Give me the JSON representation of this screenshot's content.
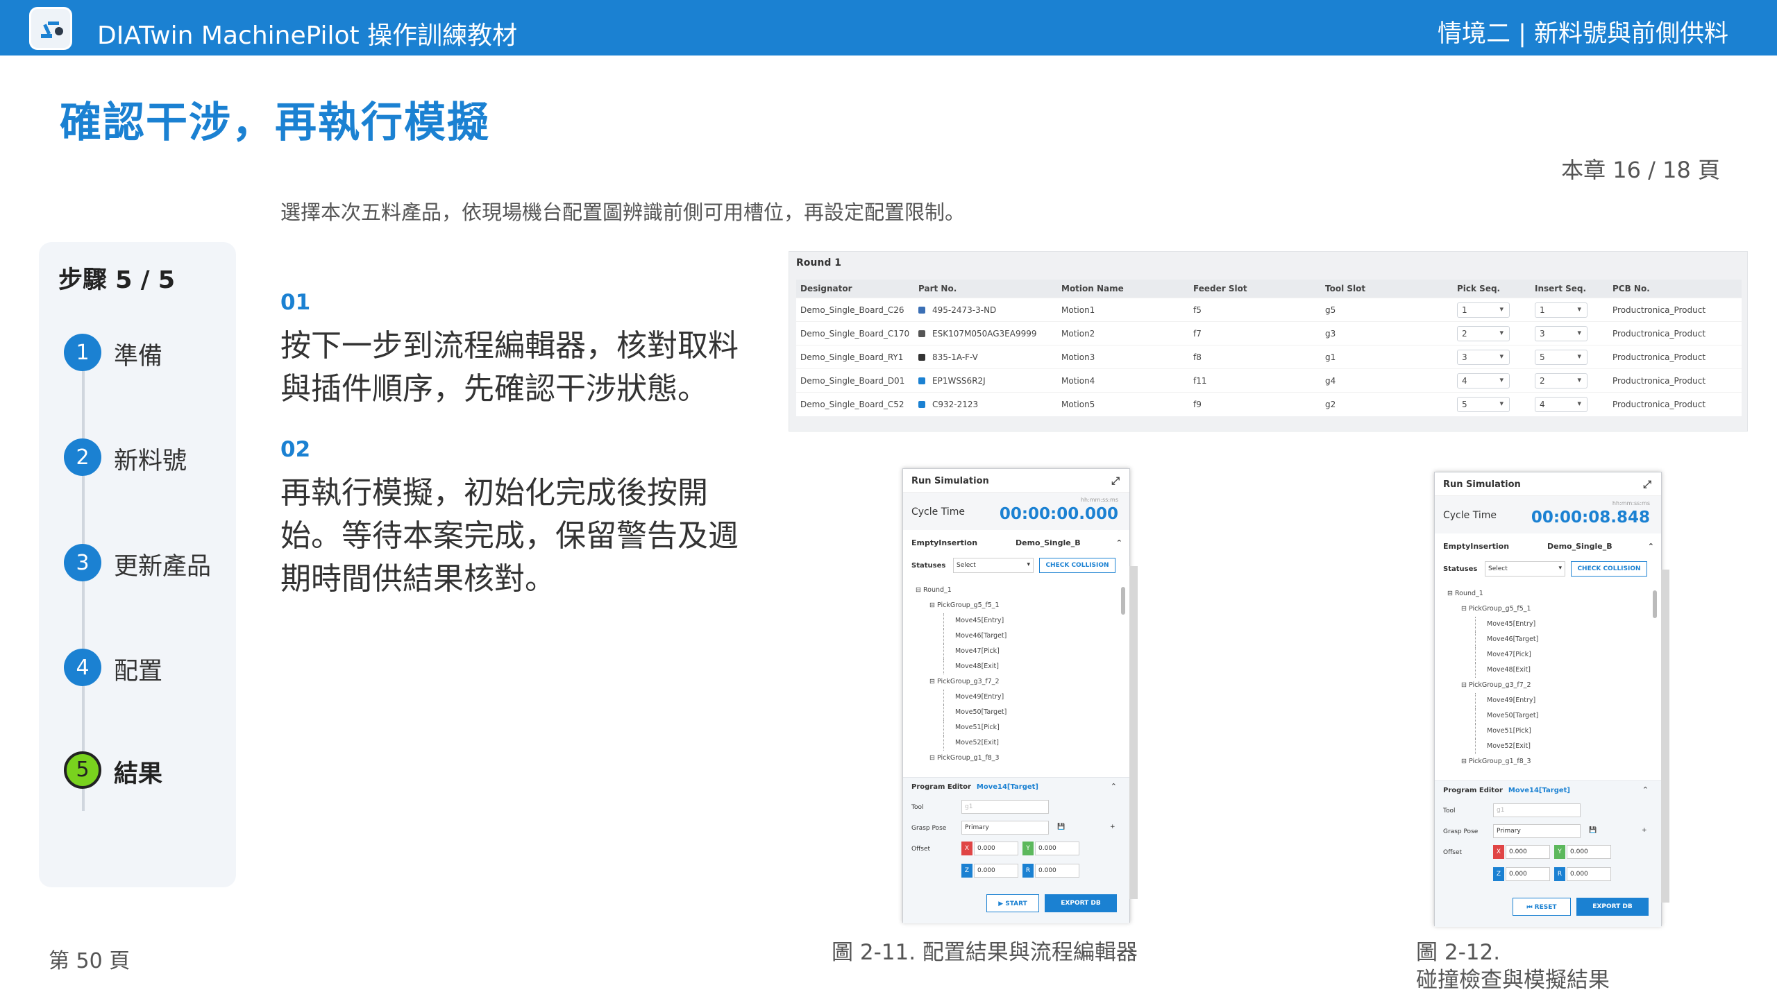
{
  "header": {
    "app_title": "DIATwin MachinePilot 操作訓練教材",
    "chapter": "情境二 | 新料號與前側供料"
  },
  "page": {
    "title": "確認干涉，再執行模擬",
    "progress": "本章 16 / 18 頁",
    "subtitle": "選擇本次五料產品，依現場機台配置圖辨識前側可用槽位，再設定配置限制。",
    "footer": "第 50 頁"
  },
  "steps": {
    "heading": "步驟 5 / 5",
    "items": [
      {
        "num": "1",
        "label": "準備"
      },
      {
        "num": "2",
        "label": "新料號"
      },
      {
        "num": "3",
        "label": "更新產品"
      },
      {
        "num": "4",
        "label": "配置"
      },
      {
        "num": "5",
        "label": "結果"
      }
    ]
  },
  "blocks": [
    {
      "num": "01",
      "text": "按下一步到流程編輯器，核對取料與插件順序，先確認干涉狀態。"
    },
    {
      "num": "02",
      "text": "再執行模擬，初始化完成後按開始。等待本案完成，保留警告及週期時間供結果核對。"
    }
  ],
  "table": {
    "round": "Round 1",
    "columns": [
      "Designator",
      "Part No.",
      "Motion Name",
      "Feeder Slot",
      "Tool Slot",
      "Pick Seq.",
      "Insert Seq.",
      "PCB No."
    ],
    "rows": [
      [
        "Demo_Single_Board_C26",
        "495-2473-3-ND",
        "Motion1",
        "f5",
        "g5",
        "1",
        "1",
        "Productronica_Product"
      ],
      [
        "Demo_Single_Board_C170",
        "ESK107M050AG3EA9999",
        "Motion2",
        "f7",
        "g3",
        "2",
        "3",
        "Productronica_Product"
      ],
      [
        "Demo_Single_Board_RY1",
        "835-1A-F-V",
        "Motion3",
        "f8",
        "g1",
        "3",
        "5",
        "Productronica_Product"
      ],
      [
        "Demo_Single_Board_D01",
        "EP1WSS6R2J",
        "Motion4",
        "f11",
        "g4",
        "4",
        "2",
        "Productronica_Product"
      ],
      [
        "Demo_Single_Board_C52",
        "C932-2123",
        "Motion5",
        "f9",
        "g2",
        "5",
        "4",
        "Productronica_Product"
      ]
    ]
  },
  "sim1": {
    "title": "Run Simulation",
    "cycle_label": "Cycle Time",
    "format": "hh:mm:ss:ms",
    "time": "00:00:00.000",
    "a1": "EmptyInsertion",
    "a2": "Demo_Single_B",
    "statuses": "Statuses",
    "select": "Select",
    "check": "CHECK COLLISION",
    "tree": [
      "Round_1",
      "PickGroup_g5_f5_1",
      "Move45[Entry]",
      "Move46[Target]",
      "Move47[Pick]",
      "Move48[Exit]",
      "PickGroup_g3_f7_2",
      "Move49[Entry]",
      "Move50[Target]",
      "Move51[Pick]",
      "Move52[Exit]",
      "PickGroup_g1_f8_3"
    ],
    "pe_label": "Program Editor",
    "pe_target": "Move14[Target]",
    "tool": "Tool",
    "tool_val": "g1",
    "grasp": "Grasp Pose",
    "grasp_val": "Primary",
    "offset": "Offset",
    "x": "0.000",
    "y": "0.000",
    "z": "0.000",
    "rz": "0.000",
    "btn_left": "▶ START",
    "btn_right": "EXPORT DB"
  },
  "sim2": {
    "title": "Run Simulation",
    "cycle_label": "Cycle Time",
    "format": "hh:mm:ss:ms",
    "time": "00:00:08.848",
    "a1": "EmptyInsertion",
    "a2": "Demo_Single_B",
    "statuses": "Statuses",
    "select": "Select",
    "check": "CHECK COLLISION",
    "tree": [
      "Round_1",
      "PickGroup_g5_f5_1",
      "Move45[Entry]",
      "Move46[Target]",
      "Move47[Pick]",
      "Move48[Exit]",
      "PickGroup_g3_f7_2",
      "Move49[Entry]",
      "Move50[Target]",
      "Move51[Pick]",
      "Move52[Exit]",
      "PickGroup_g1_f8_3"
    ],
    "pe_label": "Program Editor",
    "pe_target": "Move14[Target]",
    "tool": "Tool",
    "tool_val": "g1",
    "grasp": "Grasp Pose",
    "grasp_val": "Primary",
    "offset": "Offset",
    "x": "0.000",
    "y": "0.000",
    "z": "0.000",
    "rz": "0.000",
    "btn_left": "⏮ RESET",
    "btn_right": "EXPORT DB"
  },
  "captions": {
    "fig1": "圖 2-11. 配置結果與流程編輯器",
    "fig2_line1": "圖 2-12.",
    "fig2_line2": "碰撞檢查與模擬結果"
  },
  "colors": {
    "brand": "#1b81d2",
    "done": "#79d21e"
  }
}
